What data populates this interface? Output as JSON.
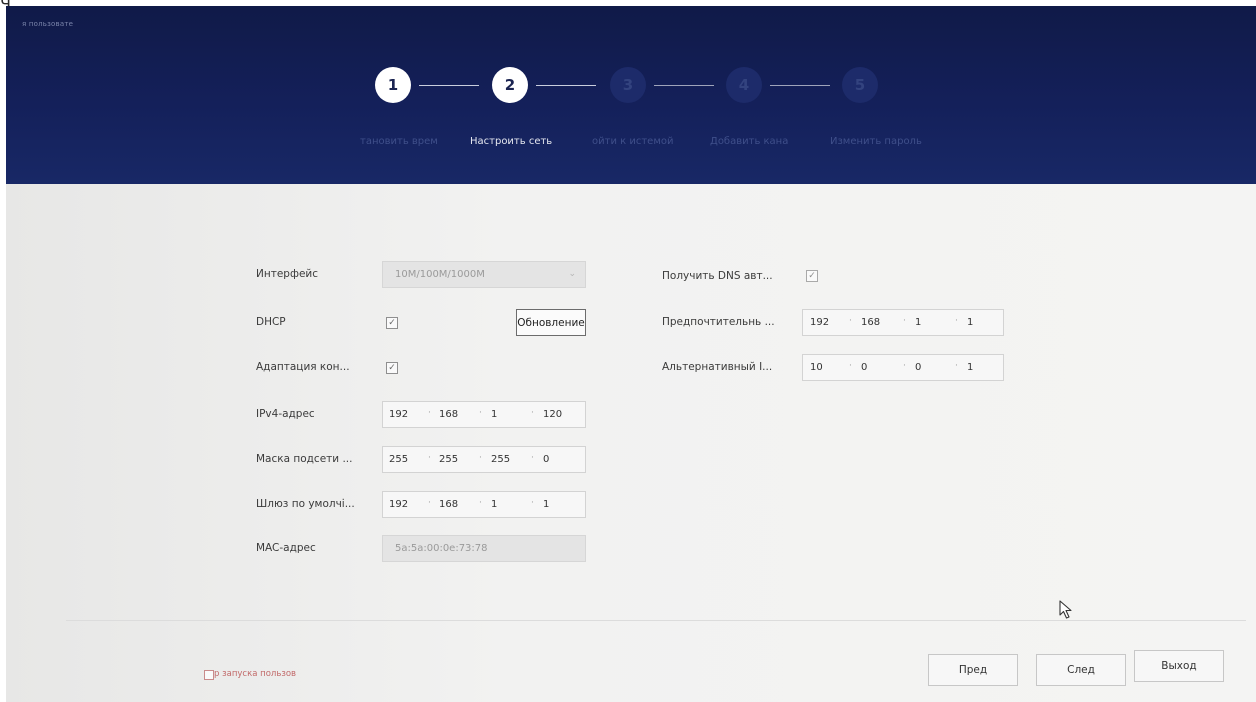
{
  "corner_text": "Ч",
  "header": {
    "user_label": "я пользовате"
  },
  "steps": [
    {
      "number": "1",
      "label": "тановить врем",
      "state": "done"
    },
    {
      "number": "2",
      "label": "Настроить сеть",
      "state": "current"
    },
    {
      "number": "3",
      "label": "ойти к истемой",
      "state": "pending"
    },
    {
      "number": "4",
      "label": "Добавить кана",
      "state": "pending"
    },
    {
      "number": "5",
      "label": "Изменить пароль",
      "state": "pending"
    }
  ],
  "form": {
    "interface_label": "Интерфейс",
    "interface_value": "10M/100M/1000M",
    "dhcp_label": "DHCP",
    "dhcp_checked": true,
    "update_button": "Обновление",
    "adapt_label": "Адаптация кон...",
    "adapt_checked": true,
    "ipv4_label": "IPv4-адрес",
    "ipv4": [
      "192",
      "168",
      "1",
      "120"
    ],
    "mask_label": "Маска подсети ...",
    "mask": [
      "255",
      "255",
      "255",
      "0"
    ],
    "gateway_label": "Шлюз по умолчі...",
    "gateway": [
      "192",
      "168",
      "1",
      "1"
    ],
    "mac_label": "MAC-адрес",
    "mac_value": "5a:5a:00:0e:73:78",
    "dns_auto_label": "Получить DNS авт...",
    "dns_auto_checked": true,
    "preferred_label": "Предпочтительнь ...",
    "preferred": [
      "192",
      "168",
      "1",
      "1"
    ],
    "alternate_label": "Альтернативный I...",
    "alternate": [
      "10",
      "0",
      "0",
      "1"
    ]
  },
  "footer": {
    "startup_text": "р запуска пользов",
    "prev_button": "Пред",
    "next_button": "След",
    "exit_button": "Выход"
  },
  "colors": {
    "header_bg": "#14205a",
    "active_step": "#ffffff",
    "inactive_step": "#1d2b6a",
    "accent_red": "#c26a6a"
  }
}
